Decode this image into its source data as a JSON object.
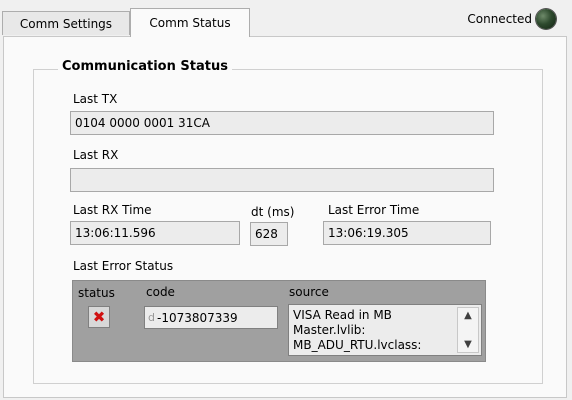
{
  "tabs": [
    {
      "label": "Comm Settings",
      "active": false
    },
    {
      "label": "Comm Status",
      "active": true
    }
  ],
  "connection": {
    "label": "Connected",
    "led_color": "#2e4a2e",
    "led_icon": "status-led-icon"
  },
  "group": {
    "title": "Communication Status"
  },
  "last_tx": {
    "label": "Last TX",
    "value": "0104 0000 0001 31CA"
  },
  "last_rx": {
    "label": "Last RX",
    "value": ""
  },
  "last_rx_time": {
    "label": "Last RX Time",
    "value": "13:06:11.596"
  },
  "dt": {
    "label": "dt (ms)",
    "value": "628"
  },
  "last_error_time": {
    "label": "Last Error Time",
    "value": "13:06:19.305"
  },
  "error_cluster": {
    "label": "Last Error Status",
    "status_label": "status",
    "status_icon": "x-error-icon",
    "status_symbol": "✖",
    "code_label": "code",
    "code_radix": "d",
    "code_value": "-1073807339",
    "source_label": "source",
    "source_value": "VISA Read in MB Master.lvlib:\nMB_ADU_RTU.lvclass:"
  }
}
